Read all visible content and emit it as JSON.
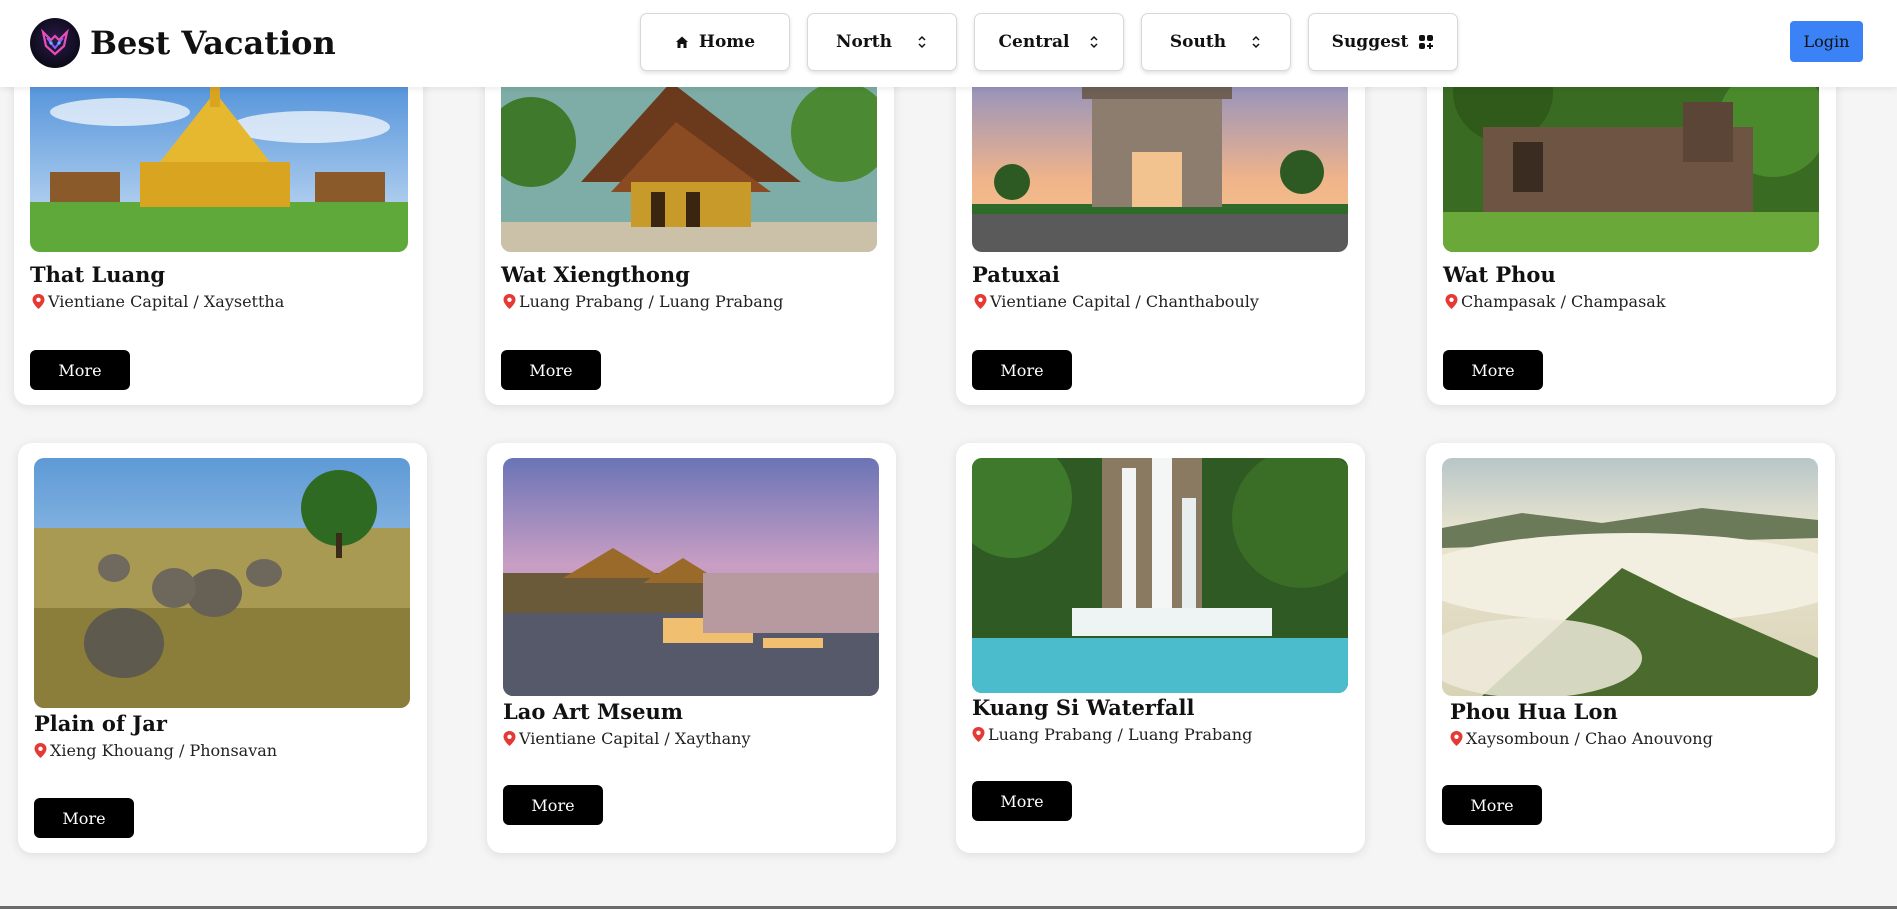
{
  "brand": {
    "title": "Best Vacation"
  },
  "nav": {
    "home": "Home",
    "north": "North",
    "central": "Central",
    "south": "South",
    "suggest": "Suggest",
    "login": "Login"
  },
  "colors": {
    "login_bg": "#3b82f6",
    "more_bg": "#000000",
    "pin": "#e53935"
  },
  "cards": [
    {
      "title": "That Luang",
      "location": "Vientiane Capital / Xaysettha",
      "more": "More",
      "image": "golden-stupa"
    },
    {
      "title": "Wat Xiengthong",
      "location": "Luang Prabang / Luang Prabang",
      "more": "More",
      "image": "temple-roof"
    },
    {
      "title": "Patuxai",
      "location": "Vientiane Capital / Chanthabouly",
      "more": "More",
      "image": "victory-gate"
    },
    {
      "title": "Wat Phou",
      "location": "Champasak / Champasak",
      "more": "More",
      "image": "stone-ruins"
    },
    {
      "title": "Plain of Jar",
      "location": "Xieng Khouang / Phonsavan",
      "more": "More",
      "image": "stone-jars"
    },
    {
      "title": "Lao Art Mseum",
      "location": "Vientiane Capital / Xaythany",
      "more": "More",
      "image": "riverside-palace"
    },
    {
      "title": "Kuang Si Waterfall",
      "location": "Luang Prabang / Luang Prabang",
      "more": "More",
      "image": "waterfall"
    },
    {
      "title": "Phou Hua Lon",
      "location": "Xaysomboun / Chao Anouvong",
      "more": "More",
      "image": "misty-mountains"
    }
  ]
}
